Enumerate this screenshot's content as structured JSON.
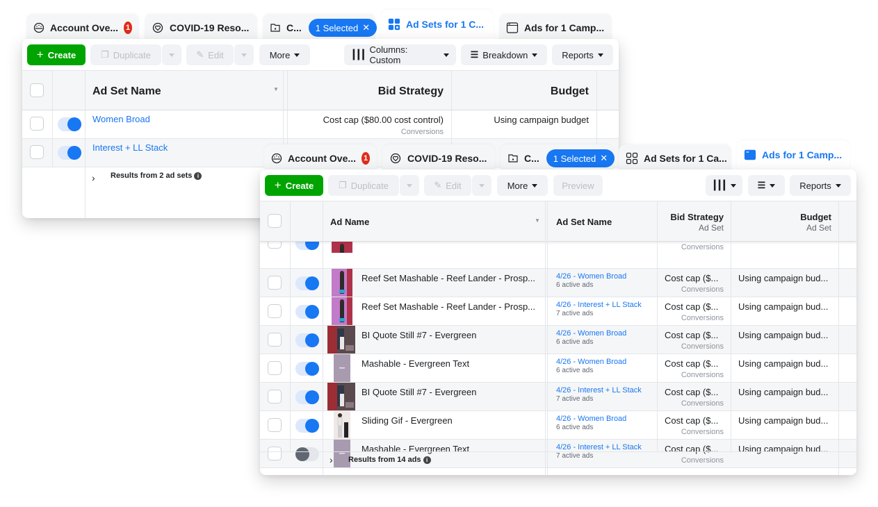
{
  "back_window": {
    "tabs": [
      {
        "icon": "dashboard-icon",
        "label": "Account Ove...",
        "badge": "1"
      },
      {
        "icon": "heart-circle-icon",
        "label": "COVID-19 Reso..."
      },
      {
        "icon": "folder-icon",
        "label": "C...",
        "pill": "1 Selected"
      },
      {
        "icon": "grid-icon",
        "label": "Ad Sets for 1 C...",
        "active": true
      },
      {
        "icon": "window-icon",
        "label": "Ads for 1 Camp..."
      }
    ],
    "toolbar": {
      "create": "Create",
      "duplicate": "Duplicate",
      "edit": "Edit",
      "more": "More",
      "columns": "Columns: Custom",
      "breakdown": "Breakdown",
      "reports": "Reports"
    },
    "columns": {
      "name": "Ad Set Name",
      "bid": "Bid Strategy",
      "budget": "Budget"
    },
    "rows": [
      {
        "name": "Women Broad",
        "bid": "Cost cap ($80.00 cost control)",
        "bid_sub": "Conversions",
        "budget": "Using campaign budget",
        "on": true
      },
      {
        "name": "Interest + LL Stack",
        "on": true
      }
    ],
    "footer": "Results from 2 ad sets"
  },
  "front_window": {
    "tabs": [
      {
        "icon": "dashboard-icon",
        "label": "Account Ove...",
        "badge": "1"
      },
      {
        "icon": "heart-circle-icon",
        "label": "COVID-19 Reso..."
      },
      {
        "icon": "folder-icon",
        "label": "C...",
        "pill": "1 Selected"
      },
      {
        "icon": "grid-icon",
        "label": "Ad Sets for 1 Ca..."
      },
      {
        "icon": "window-icon",
        "label": "Ads for 1 Camp...",
        "active": true
      }
    ],
    "toolbar": {
      "create": "Create",
      "duplicate": "Duplicate",
      "edit": "Edit",
      "more": "More",
      "preview": "Preview",
      "reports": "Reports"
    },
    "columns": {
      "name": "Ad Name",
      "adset": "Ad Set Name",
      "bid": "Bid Strategy",
      "bid_sub": "Ad Set",
      "budget": "Budget",
      "budget_sub": "Ad Set"
    },
    "partial_row": {
      "bid_sub": "Conversions"
    },
    "rows": [
      {
        "name": "Reef Set Mashable - Reef Lander - Prosp...",
        "adset": "4/26 - Women Broad",
        "adset_sub": "6 active ads",
        "bid": "Cost cap ($...",
        "bid_sub": "Conversions",
        "budget": "Using campaign bud...",
        "on": true,
        "thumb": "reef"
      },
      {
        "name": "Reef Set Mashable - Reef Lander - Prosp...",
        "adset": "4/26 - Interest + LL Stack",
        "adset_sub": "7 active ads",
        "bid": "Cost cap ($...",
        "bid_sub": "Conversions",
        "budget": "Using campaign bud...",
        "on": true,
        "thumb": "reef"
      },
      {
        "name": "BI Quote Still #7 - Evergreen",
        "adset": "4/26 - Women Broad",
        "adset_sub": "6 active ads",
        "bid": "Cost cap ($...",
        "bid_sub": "Conversions",
        "budget": "Using campaign bud...",
        "on": true,
        "thumb": "bi"
      },
      {
        "name": "Mashable - Evergreen Text",
        "adset": "4/26 - Women Broad",
        "adset_sub": "6 active ads",
        "bid": "Cost cap ($...",
        "bid_sub": "Conversions",
        "budget": "Using campaign bud...",
        "on": true,
        "thumb": "mash"
      },
      {
        "name": "BI Quote Still #7 - Evergreen",
        "adset": "4/26 - Interest + LL Stack",
        "adset_sub": "7 active ads",
        "bid": "Cost cap ($...",
        "bid_sub": "Conversions",
        "budget": "Using campaign bud...",
        "on": true,
        "thumb": "bi"
      },
      {
        "name": "Sliding Gif - Evergreen",
        "adset": "4/26 - Women Broad",
        "adset_sub": "6 active ads",
        "bid": "Cost cap ($...",
        "bid_sub": "Conversions",
        "budget": "Using campaign bud...",
        "on": true,
        "thumb": "gif"
      },
      {
        "name": "Mashable - Evergreen Text",
        "adset": "4/26 - Interest + LL Stack",
        "adset_sub": "7 active ads",
        "bid": "Cost cap ($...",
        "bid_sub": "Conversions",
        "budget": "Using campaign bud...",
        "on": false,
        "thumb": "mash"
      }
    ],
    "footer": "Results from 14 ads"
  },
  "colors": {
    "accent": "#1877f2",
    "create_green": "#00a400",
    "badge_red": "#e02c1a"
  }
}
